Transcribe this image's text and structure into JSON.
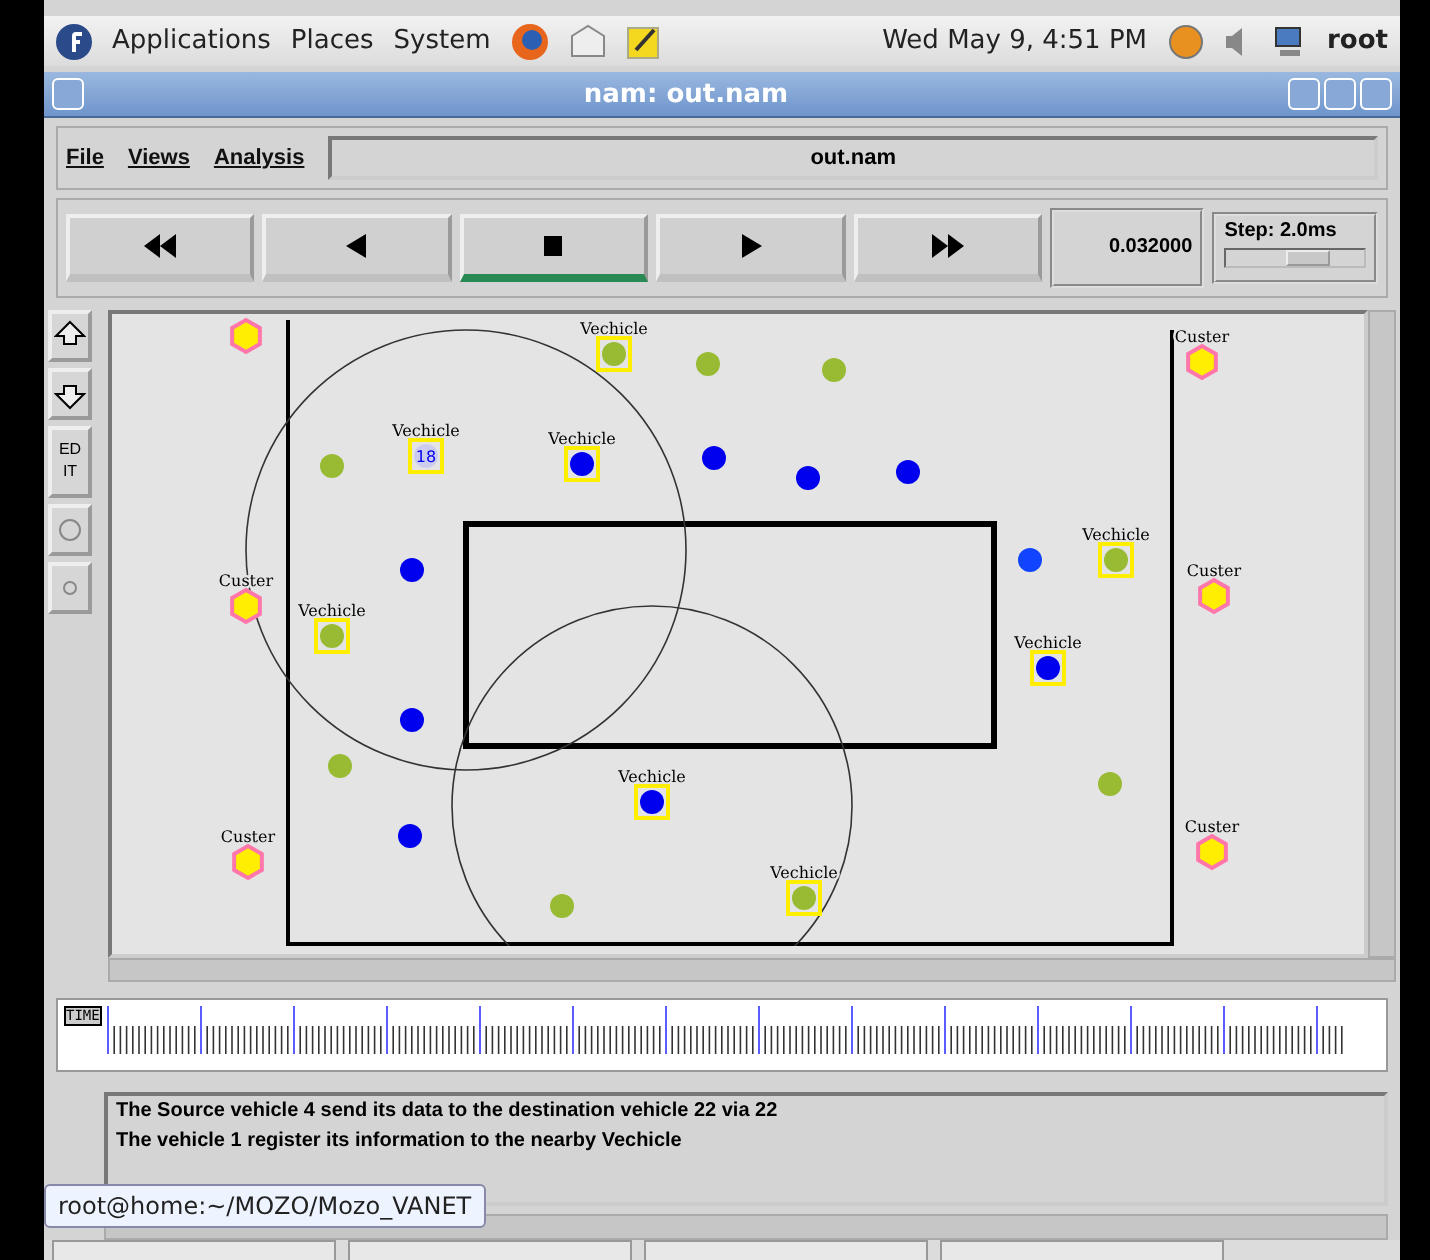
{
  "top_panel": {
    "menus": [
      "Applications",
      "Places",
      "System"
    ],
    "clock": "Wed May  9,  4:51 PM",
    "user": "root"
  },
  "window": {
    "title": "nam: out.nam"
  },
  "menu": [
    "File",
    "Views",
    "Analysis"
  ],
  "file_field": "out.nam",
  "controls": [
    {
      "kind": "rewind",
      "selected": false
    },
    {
      "kind": "back",
      "selected": false
    },
    {
      "kind": "stop",
      "selected": true
    },
    {
      "kind": "play",
      "selected": false
    },
    {
      "kind": "forward",
      "selected": false
    }
  ],
  "time": "0.032000",
  "step": {
    "label": "Step: 2.0ms",
    "level": 0.6
  },
  "edit_button": "ED IT",
  "nodes": [
    {
      "kind": "custer",
      "color": "#ff77aa"
    },
    {
      "kind": "custer",
      "label": "Custer",
      "color": "#ff77aa"
    },
    {
      "kind": "custer",
      "label": "Custer",
      "color": "#ff77aa"
    },
    {
      "kind": "custer",
      "label": "Custer",
      "color": "#ff77aa"
    },
    {
      "kind": "custer",
      "label": "Custer",
      "color": "#ff77aa"
    },
    {
      "kind": "custer",
      "label": "Custer",
      "color": "#ff77aa"
    },
    {
      "kind": "vehicle",
      "label": "Vechicle",
      "color": "#99bb33"
    },
    {
      "kind": "vehicle",
      "label": "Vechicle",
      "number": "18",
      "color": "#ccccee"
    },
    {
      "kind": "vehicle",
      "label": "Vechicle",
      "color": "#0000ee"
    },
    {
      "kind": "vehicle",
      "label": "Vechicle",
      "color": "#99bb33"
    },
    {
      "kind": "vehicle",
      "label": "Vechicle",
      "color": "#0000ee"
    },
    {
      "kind": "vehicle",
      "label": "Vechicle",
      "color": "#99bb33"
    },
    {
      "kind": "vehicle",
      "label": "Vechicle",
      "color": "#99bb33"
    },
    {
      "kind": "vehicle",
      "label": "Vechicle",
      "color": "#0000ee"
    },
    {
      "kind": "node",
      "color": "#99bb33"
    },
    {
      "kind": "node",
      "color": "#99bb33"
    },
    {
      "kind": "node",
      "color": "#99bb33"
    },
    {
      "kind": "node",
      "color": "#99bb33"
    },
    {
      "kind": "node",
      "color": "#99bb33"
    },
    {
      "kind": "node",
      "color": "#99bb33"
    },
    {
      "kind": "node",
      "color": "#0000ee"
    },
    {
      "kind": "node",
      "color": "#0000ee"
    },
    {
      "kind": "node",
      "color": "#0000ee"
    },
    {
      "kind": "node",
      "color": "#0000ee"
    },
    {
      "kind": "node",
      "color": "#0000ee"
    },
    {
      "kind": "node",
      "color": "#0000ee"
    },
    {
      "kind": "node",
      "color": "#1144ff"
    }
  ],
  "timeline_label": "TIME",
  "messages": [
    "The Source vehicle 4 send its data to the destination vehicle 22 via 22",
    "The vehicle 1 register its information to the nearby Vechicle"
  ],
  "tooltip": "root@home:~/MOZO/Mozo_VANET"
}
